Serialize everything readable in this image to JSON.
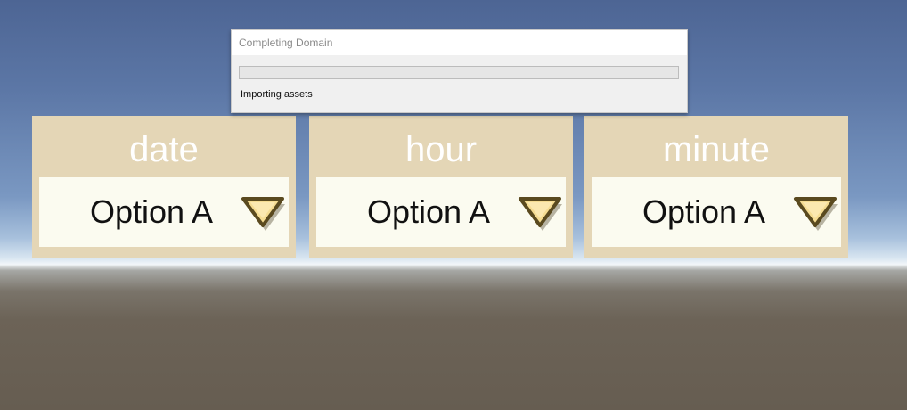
{
  "dialog": {
    "title": "Completing Domain",
    "progress": 0,
    "status": "Importing assets"
  },
  "panels": [
    {
      "title": "date",
      "value": "Option A",
      "arrow_icon": "triangle-down-icon"
    },
    {
      "title": "hour",
      "value": "Option A",
      "arrow_icon": "triangle-down-icon"
    },
    {
      "title": "minute",
      "value": "Option A",
      "arrow_icon": "triangle-down-icon"
    }
  ],
  "colors": {
    "panel_bg": "#e4d6b6",
    "dropdown_bg": "#fbfbf0",
    "arrow_fill": "#f5dc92",
    "arrow_outline": "#5a4a1f"
  }
}
